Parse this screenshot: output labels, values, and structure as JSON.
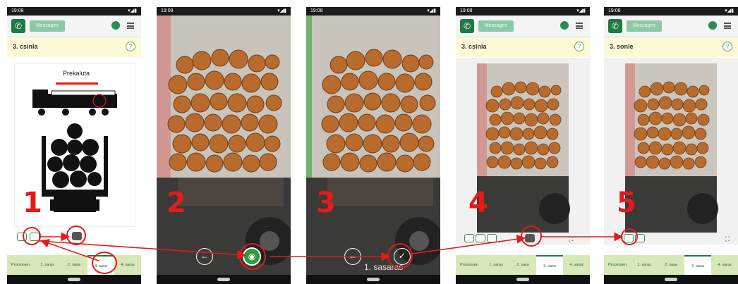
{
  "screens": [
    {
      "status_time": "19:08",
      "status_icons": "▾◢▮",
      "message_button": "Messages",
      "subtitle": "3. csinla",
      "scheme_label": "Prekaluta",
      "step_number": "1",
      "tabs": [
        "Processen",
        "1. saras",
        "2. sasa",
        "3. sasa",
        "4. saras"
      ],
      "active_tab": 3
    },
    {
      "status_time": "19:08",
      "status_icons": "▾◢▮",
      "step_number": "2"
    },
    {
      "status_time": "19:08",
      "status_icons": "▾◢▮",
      "step_number": "3",
      "photo_caption": "1. sasaras"
    },
    {
      "status_time": "19:08",
      "status_icons": "▾◢▮",
      "message_button": "Messages",
      "subtitle": "3. csinla",
      "step_number": "4",
      "tabs": [
        "Processen",
        "1. saras",
        "2. sasa",
        "3. sasa",
        "4. saras"
      ],
      "active_tab": 3
    },
    {
      "status_time": "19:08",
      "status_icons": "▾◢▮",
      "message_button": "Messages",
      "subtitle": "3. sonle",
      "step_number": "5",
      "tabs": [
        "Processen",
        "1. saras",
        "2. sasa",
        "3. sasa",
        "4. saras"
      ],
      "active_tab": 3
    }
  ],
  "colors": {
    "accent_green": "#1f7a44",
    "annotation_red": "#e51a1a",
    "subtitle_bg": "#fdfbd7",
    "tab_bg": "#d7e9b8"
  },
  "icons": [
    "phone-icon",
    "truck-icon",
    "menu-icon",
    "help-icon",
    "camera-icon",
    "back-arrow-icon",
    "check-icon",
    "crop-icon"
  ]
}
